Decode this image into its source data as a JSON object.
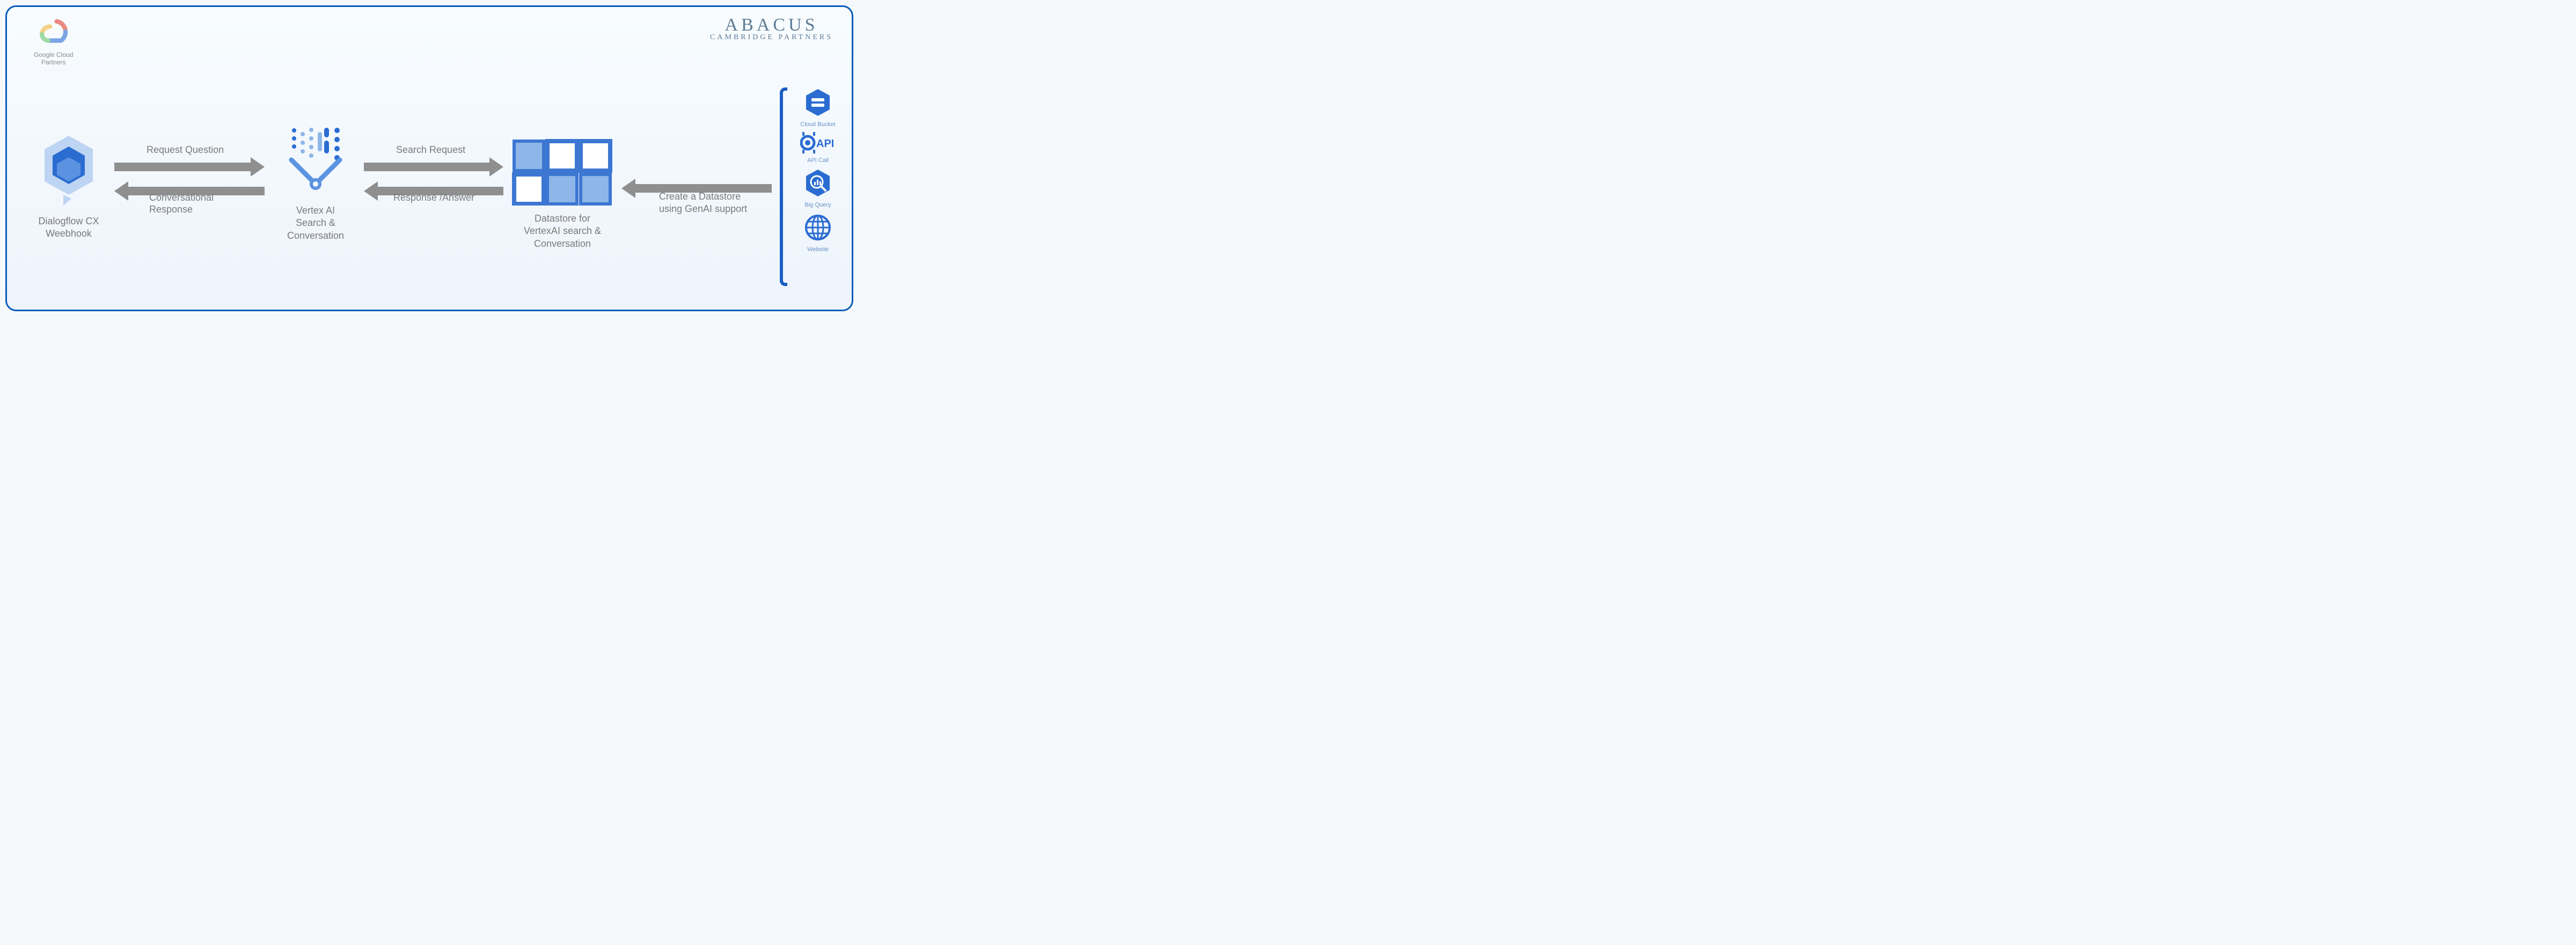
{
  "gcp_partner_label": "Google Cloud\nPartners",
  "abacus_main": "ABACUS",
  "abacus_sub": "CAMBRIDGE PARTNERS",
  "nodes": {
    "dialogflow": "Dialogflow CX\nWeebhook",
    "vertex": "Vertex AI\nSearch &\nConversation",
    "datastore": "Datastore for\nVertexAI search &\nConversation"
  },
  "arrows": {
    "a1_top": "Request Question",
    "a1_bottom": "Conversational\nResponse",
    "a2_top": "Search Request",
    "a2_bottom": "Response /Answer",
    "a3": "Create a Datastore\nusing GenAI support"
  },
  "sources": {
    "bucket": "Cloud Bucket",
    "api": "API Call",
    "bigquery": "Big Query",
    "website": "Website"
  }
}
